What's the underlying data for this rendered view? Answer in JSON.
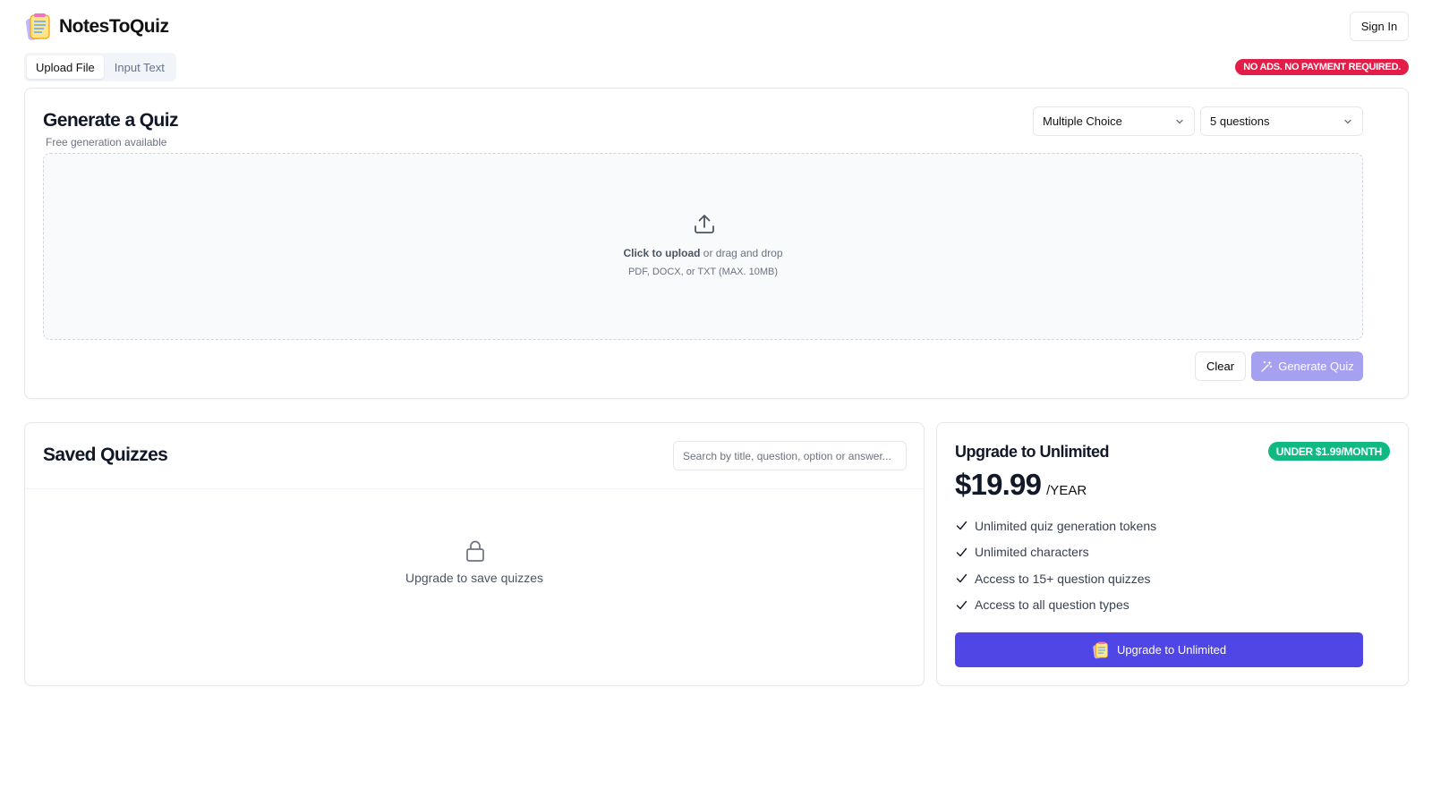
{
  "header": {
    "app_name": "NotesToQuiz",
    "sign_in_label": "Sign In"
  },
  "tabs": [
    {
      "label": "Upload File",
      "active": true
    },
    {
      "label": "Input Text",
      "active": false
    }
  ],
  "promo_badge": "NO ADS. NO PAYMENT REQUIRED.",
  "generator": {
    "title": "Generate a Quiz",
    "subtitle": "Free generation available",
    "question_type": "Multiple Choice",
    "question_count": "5 questions",
    "dropzone": {
      "action_bold": "Click to upload",
      "action_rest": " or drag and drop",
      "formats": "PDF, DOCX, or TXT (MAX. 10MB)"
    },
    "clear_label": "Clear",
    "generate_label": "Generate Quiz"
  },
  "saved": {
    "title": "Saved Quizzes",
    "search_placeholder": "Search by title, question, option or answer...",
    "empty_message": "Upgrade to save quizzes"
  },
  "upgrade": {
    "title": "Upgrade to Unlimited",
    "badge": "UNDER $1.99/MONTH",
    "price": "$19.99",
    "period": "/YEAR",
    "features": [
      "Unlimited quiz generation tokens",
      "Unlimited characters",
      "Access to 15+ question quizzes",
      "Access to all question types"
    ],
    "button_label": "Upgrade to Unlimited"
  },
  "colors": {
    "primary": "#4f46e5",
    "primary_disabled": "#a5a0f0",
    "promo_red": "#e11d48",
    "badge_green": "#10b981"
  }
}
